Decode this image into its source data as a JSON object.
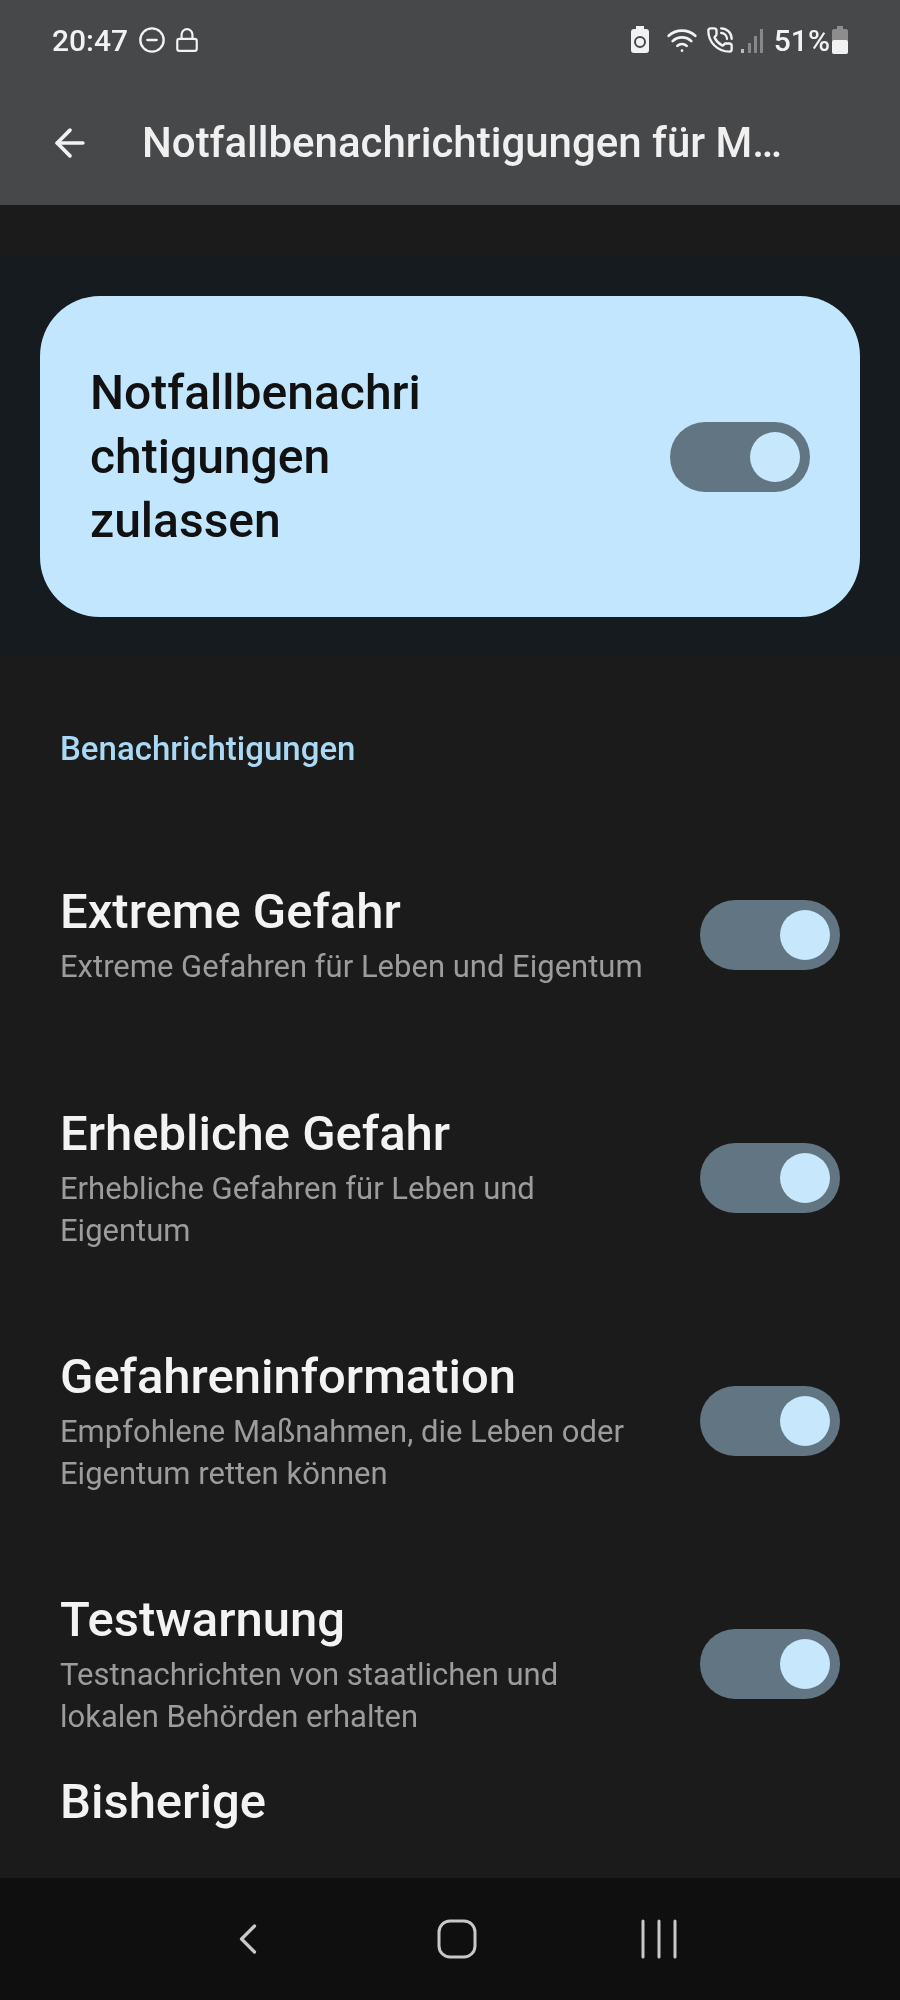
{
  "status_bar": {
    "time": "20:47",
    "battery": "51%"
  },
  "app_bar": {
    "title": "Notfallbenachrichtigungen für M…"
  },
  "master": {
    "label": "Notfallbenachrichtigungen zulassen",
    "on": true
  },
  "section": {
    "title": "Benachrichtigungen"
  },
  "items": [
    {
      "title": "Extreme Gefahr",
      "subtitle": "Extreme Gefahren für Leben und Eigentum",
      "on": true
    },
    {
      "title": "Erhebliche Gefahr",
      "subtitle": "Erhebliche Gefahren für Leben und Eigentum",
      "on": true
    },
    {
      "title": "Gefahreninformation",
      "subtitle": "Empfohlene Maßnahmen, die Leben oder Eigentum retten können",
      "on": true
    },
    {
      "title": "Testwarnung",
      "subtitle": "Testnachrichten von staatlichen und lokalen Behörden erhalten",
      "on": true
    }
  ],
  "next_heading": "Bisherige"
}
